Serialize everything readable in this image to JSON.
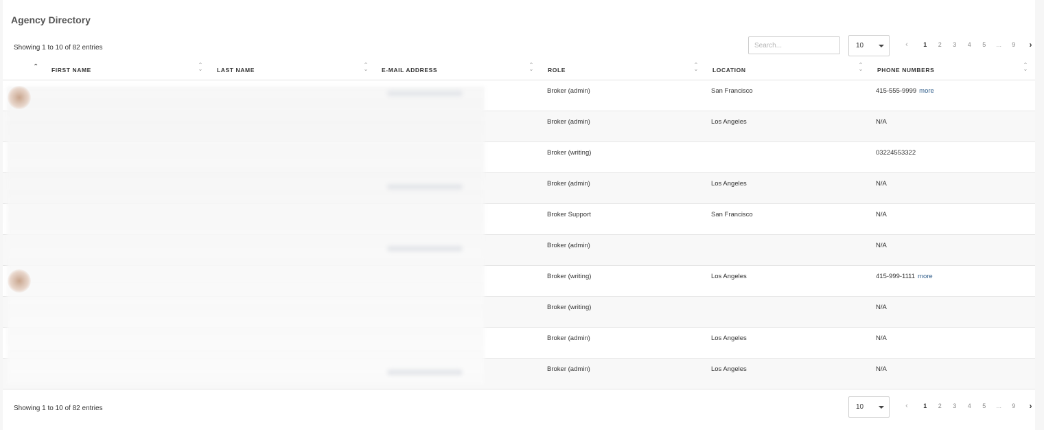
{
  "title": "Agency Directory",
  "info_text": "Showing 1 to 10 of 82 entries",
  "search": {
    "placeholder": "Search..."
  },
  "page_size": "10",
  "pagination": {
    "prev": "‹",
    "pages": [
      "1",
      "2",
      "3",
      "4",
      "5"
    ],
    "ellipsis": "...",
    "last": "9",
    "next": "›",
    "active": "1"
  },
  "columns": [
    "FIRST NAME",
    "LAST NAME",
    "E-MAIL ADDRESS",
    "ROLE",
    "LOCATION",
    "PHONE NUMBERS"
  ],
  "sort_icon": "⇳",
  "rows": [
    {
      "role": "Broker (admin)",
      "location": "San Francisco",
      "phone": "415-555-9999",
      "more": "more"
    },
    {
      "role": "Broker (admin)",
      "location": "Los Angeles",
      "phone": "N/A",
      "more": ""
    },
    {
      "role": "Broker (writing)",
      "location": "",
      "phone": "03224553322",
      "more": ""
    },
    {
      "role": "Broker (admin)",
      "location": "Los Angeles",
      "phone": "N/A",
      "more": ""
    },
    {
      "role": "Broker Support",
      "location": "San Francisco",
      "phone": "N/A",
      "more": ""
    },
    {
      "role": "Broker (admin)",
      "location": "",
      "phone": "N/A",
      "more": ""
    },
    {
      "role": "Broker (writing)",
      "location": "Los Angeles",
      "phone": "415-999-1111",
      "more": "more"
    },
    {
      "role": "Broker (writing)",
      "location": "",
      "phone": "N/A",
      "more": ""
    },
    {
      "role": "Broker (admin)",
      "location": "Los Angeles",
      "phone": "N/A",
      "more": ""
    },
    {
      "role": "Broker (admin)",
      "location": "Los Angeles",
      "phone": "N/A",
      "more": ""
    }
  ],
  "colors": {
    "link": "#2f5d8a",
    "border": "#e6e6e6",
    "alt_row": "#f8f8f8"
  }
}
